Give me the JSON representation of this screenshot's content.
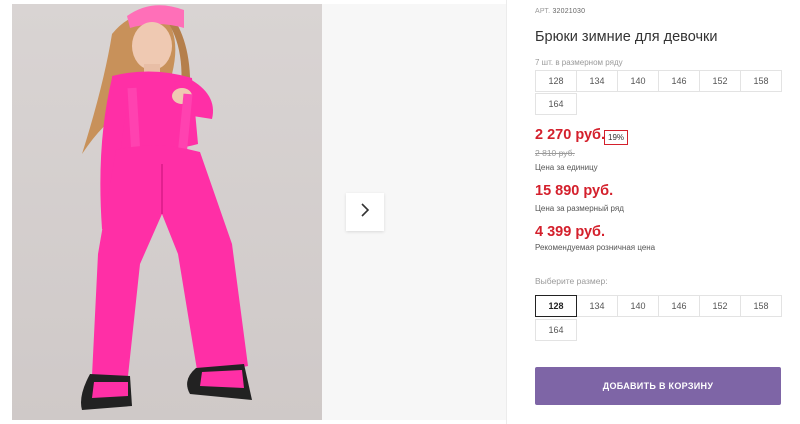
{
  "product": {
    "article_label": "АРТ.",
    "article_number": "32021030",
    "title": "Брюки зимние для девочки",
    "pack_note": "7 шт. в размерном ряду",
    "pack_sizes": [
      "128",
      "134",
      "140",
      "146",
      "152",
      "158",
      "164"
    ],
    "price": "2 270 руб.",
    "discount": "19%",
    "old_price": "2 810 руб.",
    "price_unit_label": "Цена за единицу",
    "pack_price": "15 890 руб.",
    "pack_price_label": "Цена за размерный ряд",
    "retail_price": "4 399 руб.",
    "retail_price_label": "Рекомендуемая розничная цена",
    "choose_size_label": "Выберите размер:",
    "selectable_sizes": [
      "128",
      "134",
      "140",
      "146",
      "152",
      "158",
      "164"
    ],
    "selected_size": "128",
    "add_to_cart_label": "ДОБАВИТЬ В КОРЗИНУ"
  },
  "colors": {
    "price_red": "#d4202c",
    "button_purple": "#7e65a6",
    "garment_pink": "#ff2fa6"
  },
  "gallery": {
    "next_icon": "chevron-right-icon"
  }
}
